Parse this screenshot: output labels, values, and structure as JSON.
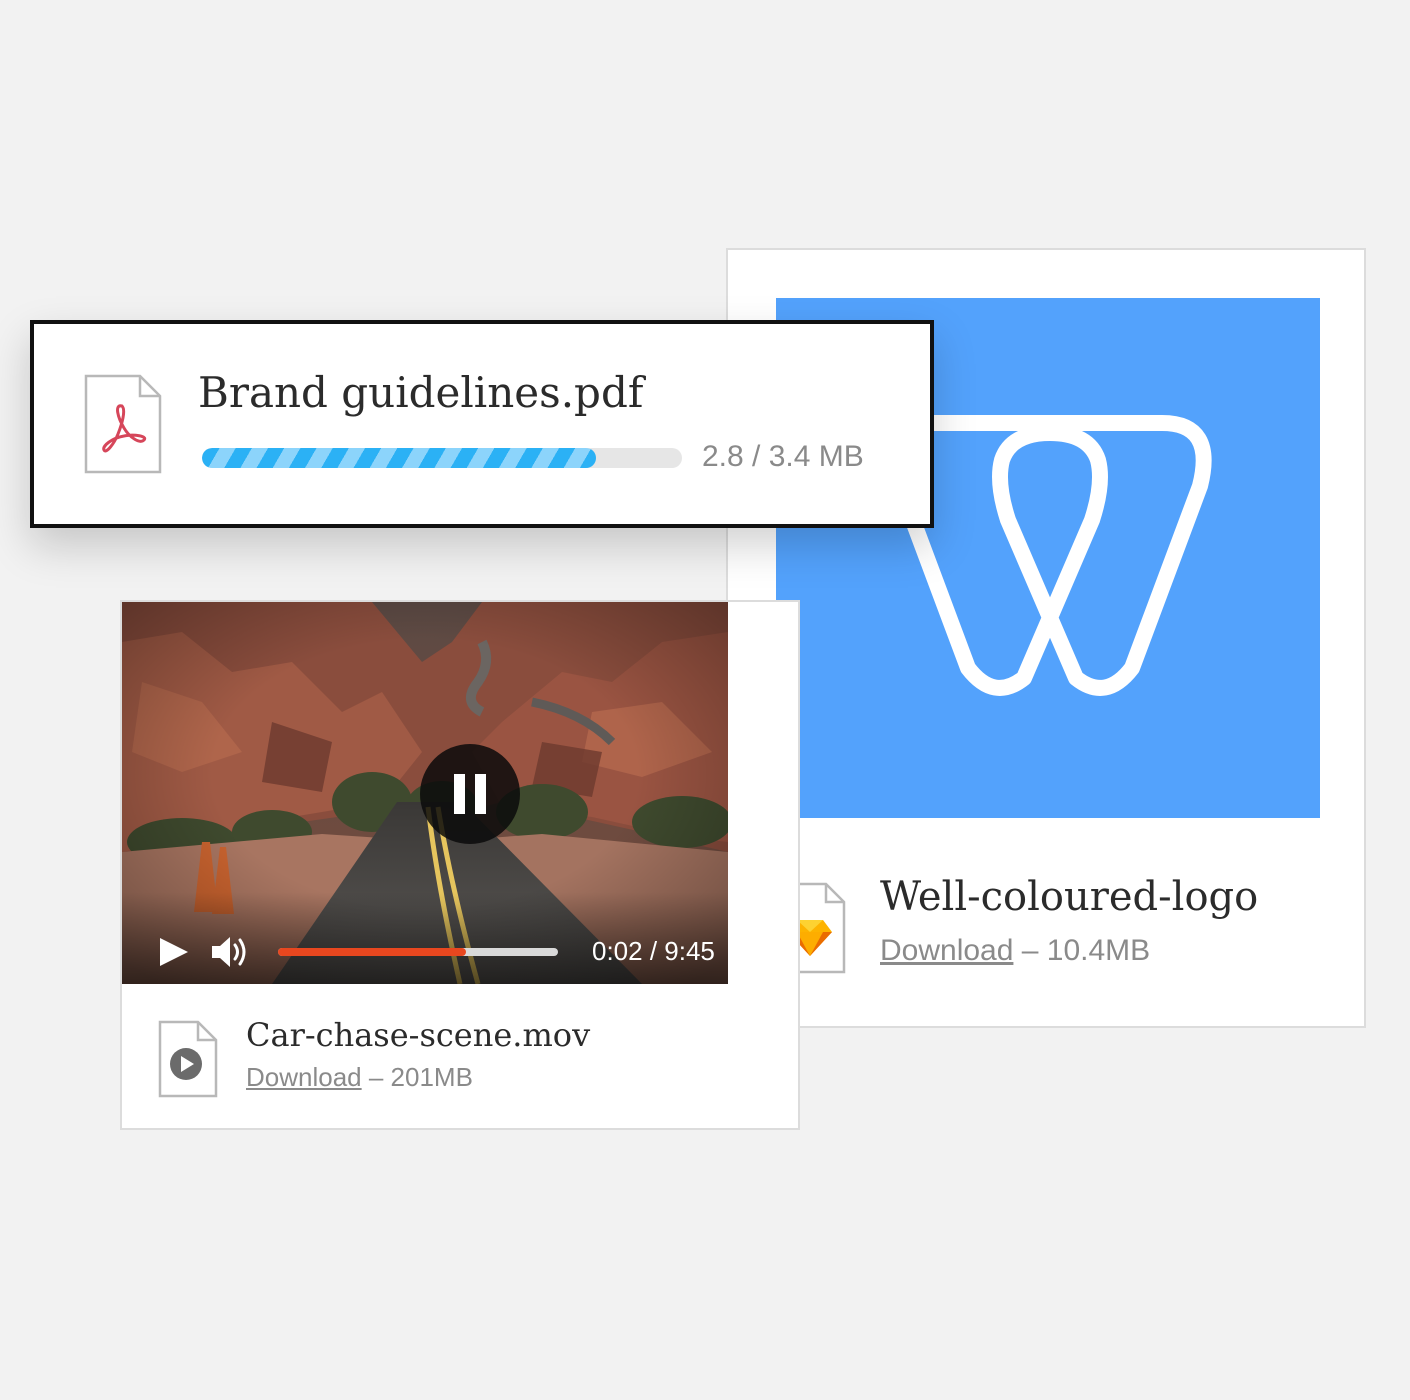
{
  "upload": {
    "file_name": "Brand guidelines.pdf",
    "progress_fraction": 0.82,
    "size_text": "2.8 / 3.4 MB",
    "icon": "pdf-file-icon",
    "progress_color": "#2bb1f5"
  },
  "logo_file": {
    "file_name": "Well-coloured-logo",
    "download_label": "Download",
    "size_text": " – 10.4MB",
    "icon": "sketch-file-icon",
    "preview_background": "#53a2fc"
  },
  "video_file": {
    "file_name": "Car-chase-scene.mov",
    "download_label": "Download",
    "size_text": " – 201MB",
    "icon": "video-file-icon",
    "player": {
      "time_text": "0:02 / 9:45",
      "played_fraction": 0.67,
      "played_color": "#e8471f"
    }
  }
}
